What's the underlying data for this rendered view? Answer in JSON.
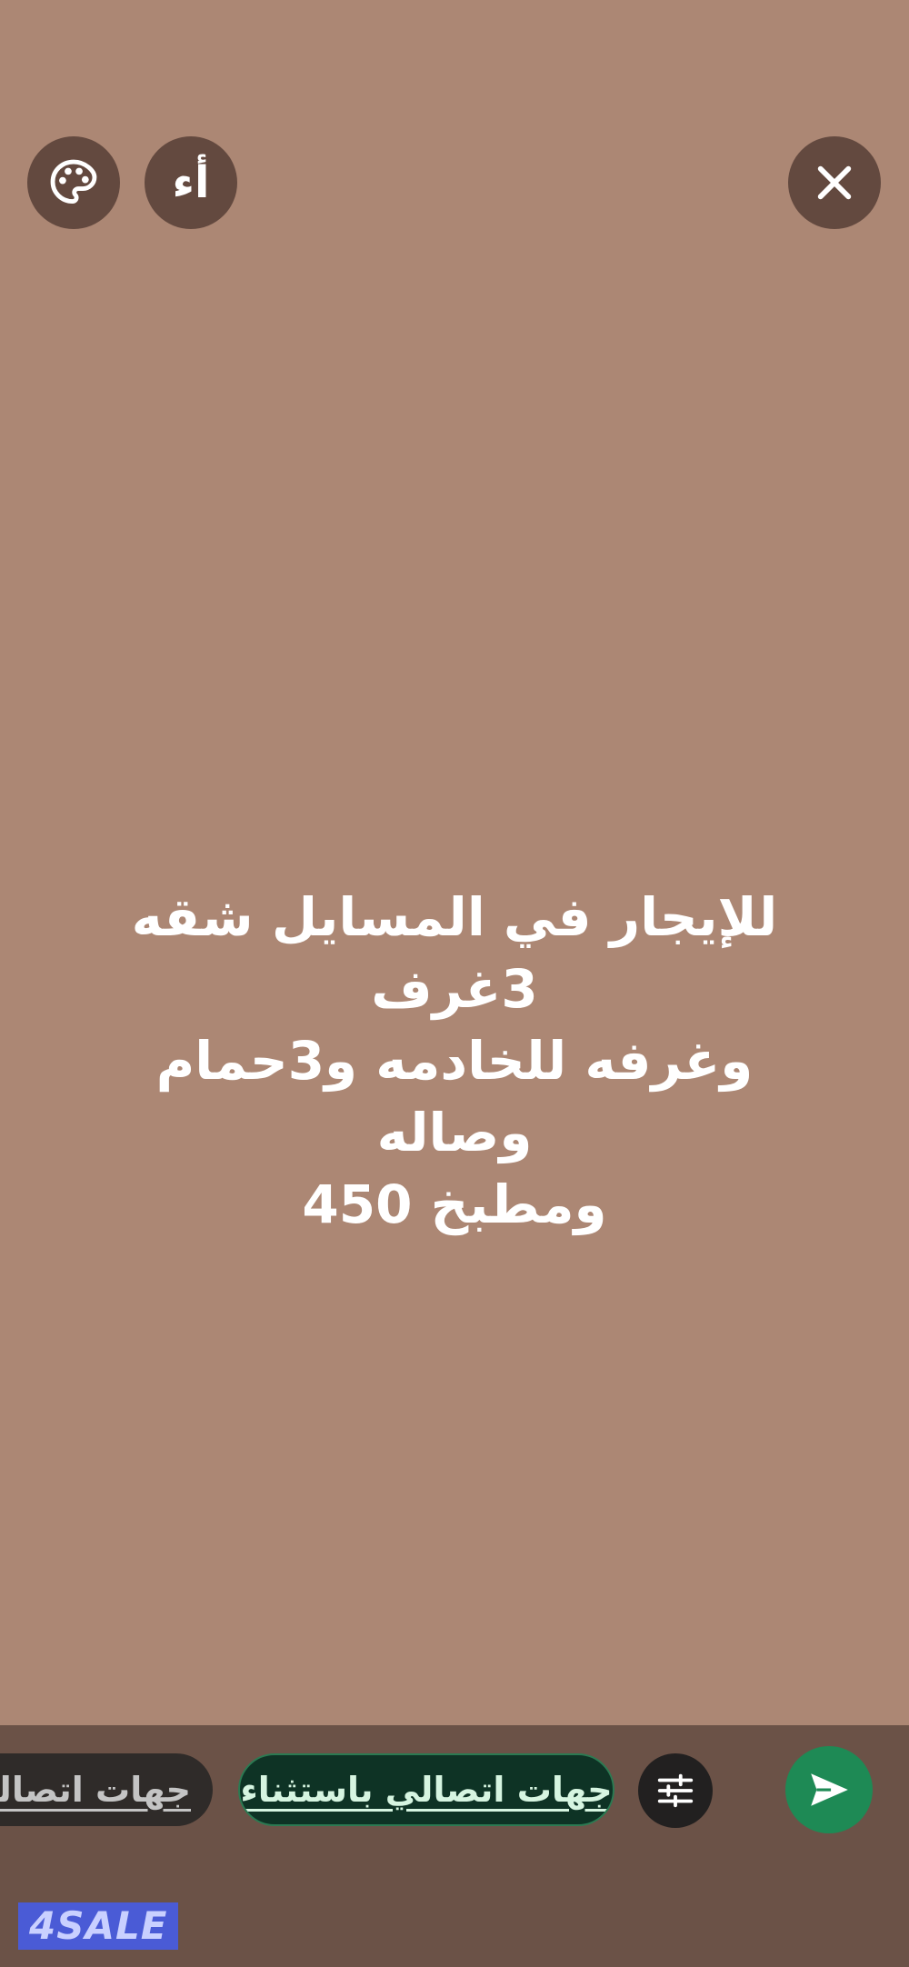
{
  "header": {
    "font_button_label": "أء",
    "icons": {
      "palette": "palette-icon",
      "close": "close-icon"
    }
  },
  "status": {
    "text": "للإيجار في المسايل شقه 3غرف\nوغرفه للخادمه و3حمام وصاله\nومطبخ 450",
    "background_color": "#ac8774"
  },
  "footer": {
    "audience_chips": [
      {
        "label": "جهات اتصالي",
        "selected": false
      },
      {
        "label": "جهات اتصالي باستثناء",
        "selected": true
      }
    ],
    "icons": {
      "filter": "sliders-icon",
      "send": "send-icon"
    },
    "accent_color": "#1e8a55"
  },
  "watermark": {
    "text": "4SALE"
  }
}
